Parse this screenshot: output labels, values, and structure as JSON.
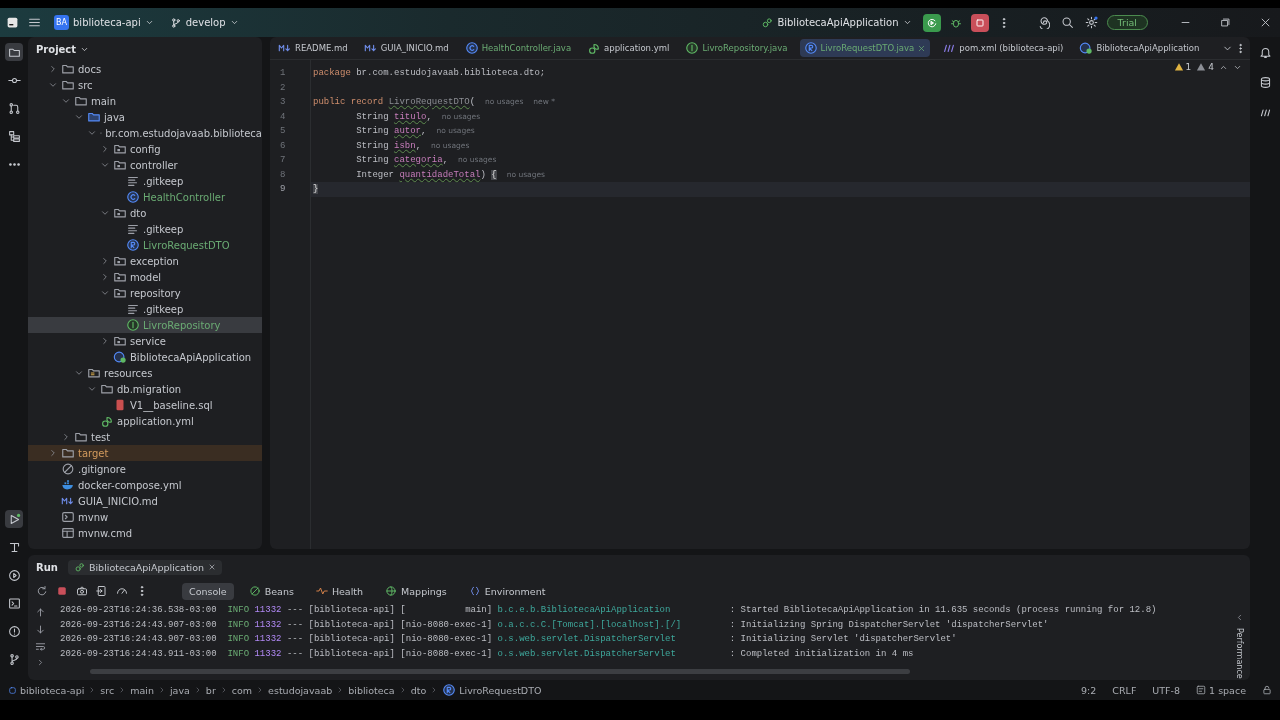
{
  "title_bar": {
    "project_badge": "BA",
    "project": "biblioteca-api",
    "branch": "develop",
    "run_config": "BibliotecaApiApplication",
    "trial": "Trial"
  },
  "project_panel": {
    "title": "Project",
    "tree": [
      {
        "label": "docs",
        "kind": "folder",
        "expanded": false,
        "selected": false
      },
      {
        "label": "src",
        "kind": "folder",
        "expanded": true,
        "selected": false,
        "children": [
          {
            "label": "main",
            "kind": "folder",
            "expanded": true,
            "selected": false,
            "children": [
              {
                "label": "java",
                "kind": "source-folder",
                "expanded": true,
                "selected": false,
                "children": [
                  {
                    "label": "br.com.estudojavaab.biblioteca",
                    "kind": "package",
                    "expanded": true,
                    "selected": false,
                    "children": [
                      {
                        "label": "config",
                        "kind": "package",
                        "expanded": false,
                        "selected": false
                      },
                      {
                        "label": "controller",
                        "kind": "package",
                        "expanded": true,
                        "selected": false,
                        "children": [
                          {
                            "label": ".gitkeep",
                            "kind": "text",
                            "selected": false
                          },
                          {
                            "label": "HealthController",
                            "kind": "class",
                            "added": true,
                            "selected": false
                          }
                        ]
                      },
                      {
                        "label": "dto",
                        "kind": "package",
                        "expanded": true,
                        "selected": false,
                        "children": [
                          {
                            "label": ".gitkeep",
                            "kind": "text",
                            "selected": false
                          },
                          {
                            "label": "LivroRequestDTO",
                            "kind": "record",
                            "added": true,
                            "selected": false
                          }
                        ]
                      },
                      {
                        "label": "exception",
                        "kind": "package",
                        "expanded": false,
                        "selected": false
                      },
                      {
                        "label": "model",
                        "kind": "package",
                        "expanded": false,
                        "selected": false
                      },
                      {
                        "label": "repository",
                        "kind": "package",
                        "expanded": true,
                        "selected": false,
                        "children": [
                          {
                            "label": ".gitkeep",
                            "kind": "text",
                            "selected": false
                          },
                          {
                            "label": "LivroRepository",
                            "kind": "interface",
                            "added": true,
                            "selected": true
                          }
                        ]
                      },
                      {
                        "label": "service",
                        "kind": "package",
                        "expanded": false,
                        "selected": false
                      },
                      {
                        "label": "BibliotecaApiApplication",
                        "kind": "spring",
                        "selected": false
                      }
                    ]
                  }
                ]
              },
              {
                "label": "resources",
                "kind": "resources-folder",
                "expanded": true,
                "selected": false,
                "children": [
                  {
                    "label": "db.migration",
                    "kind": "folder",
                    "expanded": true,
                    "selected": false,
                    "children": [
                      {
                        "label": "V1__baseline.sql",
                        "kind": "sql",
                        "selected": false
                      }
                    ]
                  },
                  {
                    "label": "application.yml",
                    "kind": "yml",
                    "selected": false
                  }
                ]
              }
            ]
          },
          {
            "label": "test",
            "kind": "folder",
            "expanded": false,
            "selected": false
          }
        ]
      },
      {
        "label": "target",
        "kind": "folder",
        "expanded": false,
        "excluded": true,
        "selected": false
      },
      {
        "label": ".gitignore",
        "kind": "ignore",
        "selected": false
      },
      {
        "label": "docker-compose.yml",
        "kind": "docker",
        "selected": false
      },
      {
        "label": "GUIA_INICIO.md",
        "kind": "md",
        "selected": false
      },
      {
        "label": "mvnw",
        "kind": "script",
        "selected": false
      },
      {
        "label": "mvnw.cmd",
        "kind": "cmd",
        "selected": false
      }
    ]
  },
  "editor_tabs": [
    {
      "label": "README.md",
      "kind": "md",
      "selected": false
    },
    {
      "label": "GUIA_INICIO.md",
      "kind": "md",
      "selected": false
    },
    {
      "label": "HealthController.java",
      "kind": "class",
      "added": true,
      "selected": false
    },
    {
      "label": "application.yml",
      "kind": "yml",
      "selected": false
    },
    {
      "label": "LivroRepository.java",
      "kind": "interface",
      "added": true,
      "selected": false
    },
    {
      "label": "LivroRequestDTO.java",
      "kind": "record",
      "added": true,
      "selected": true
    },
    {
      "label": "pom.xml (biblioteca-api)",
      "kind": "maven",
      "selected": false
    },
    {
      "label": "BibliotecaApiApplication",
      "kind": "spring",
      "selected": false
    }
  ],
  "inspections": {
    "warnings": "1",
    "weak_warnings": "4"
  },
  "code": [
    {
      "number": "1",
      "current": false,
      "tokens": [
        {
          "kind": "keyword",
          "text": "package"
        },
        {
          "kind": "plain",
          "text": " br.com.estudojavaab.biblioteca.dto;"
        }
      ]
    },
    {
      "number": "2",
      "current": false
    },
    {
      "number": "3",
      "current": false,
      "tokens": [
        {
          "kind": "keyword",
          "text": "public record "
        },
        {
          "kind": "unused",
          "text": "LivroRequestDTO"
        },
        {
          "kind": "plain",
          "text": "("
        }
      ],
      "hints": [
        "no usages",
        "new *"
      ]
    },
    {
      "number": "4",
      "current": false,
      "tokens": [
        {
          "kind": "plain",
          "text": "        String "
        },
        {
          "kind": "param",
          "text": "titulo"
        },
        {
          "kind": "plain",
          "text": ","
        }
      ],
      "hints": [
        "no usages"
      ]
    },
    {
      "number": "5",
      "current": false,
      "tokens": [
        {
          "kind": "plain",
          "text": "        String "
        },
        {
          "kind": "param",
          "text": "autor"
        },
        {
          "kind": "plain",
          "text": ","
        }
      ],
      "hints": [
        "no usages"
      ]
    },
    {
      "number": "6",
      "current": false,
      "tokens": [
        {
          "kind": "plain",
          "text": "        String "
        },
        {
          "kind": "param",
          "text": "isbn"
        },
        {
          "kind": "plain",
          "text": ","
        }
      ],
      "hints": [
        "no usages"
      ]
    },
    {
      "number": "7",
      "current": false,
      "tokens": [
        {
          "kind": "plain",
          "text": "        String "
        },
        {
          "kind": "param",
          "text": "categoria"
        },
        {
          "kind": "plain",
          "text": ","
        }
      ],
      "hints": [
        "no usages"
      ]
    },
    {
      "number": "8",
      "current": false,
      "tokens": [
        {
          "kind": "plain",
          "text": "        Integer "
        },
        {
          "kind": "param",
          "text": "quantidadeTotal"
        },
        {
          "kind": "plain",
          "text": ") "
        },
        {
          "kind": "brace-match",
          "text": "{"
        }
      ],
      "hints": [
        "no usages"
      ]
    },
    {
      "number": "9",
      "current": true,
      "tokens": [
        {
          "kind": "brace-match",
          "text": "}"
        }
      ]
    }
  ],
  "run_panel": {
    "title": "Run",
    "config_tab": "BibliotecaApiApplication",
    "tabs": [
      {
        "label": "Console",
        "kind": "console",
        "selected": true
      },
      {
        "label": "Beans",
        "kind": "beans",
        "selected": false
      },
      {
        "label": "Health",
        "kind": "health",
        "selected": false
      },
      {
        "label": "Mappings",
        "kind": "mappings",
        "selected": false
      },
      {
        "label": "Environment",
        "kind": "environment",
        "selected": false
      }
    ],
    "log": [
      {
        "time": "2026-09-23T16:24:36.538-03:00",
        "level": "INFO",
        "pid": "11332",
        "sep": "---",
        "app": "[biblioteca-api]",
        "thread": "[           main]",
        "logger": "b.c.e.b.BibliotecaApiApplication",
        "message": ": Started BibliotecaApiApplication in 11.635 seconds (process running for 12.8)"
      },
      {
        "time": "2026-09-23T16:24:43.907-03:00",
        "level": "INFO",
        "pid": "11332",
        "sep": "---",
        "app": "[biblioteca-api]",
        "thread": "[nio-8080-exec-1]",
        "logger": "o.a.c.c.C.[Tomcat].[localhost].[/]",
        "message": ": Initializing Spring DispatcherServlet 'dispatcherServlet'"
      },
      {
        "time": "2026-09-23T16:24:43.907-03:00",
        "level": "INFO",
        "pid": "11332",
        "sep": "---",
        "app": "[biblioteca-api]",
        "thread": "[nio-8080-exec-1]",
        "logger": "o.s.web.servlet.DispatcherServlet",
        "message": ": Initializing Servlet 'dispatcherServlet'"
      },
      {
        "time": "2026-09-23T16:24:43.911-03:00",
        "level": "INFO",
        "pid": "11332",
        "sep": "---",
        "app": "[biblioteca-api]",
        "thread": "[nio-8080-exec-1]",
        "logger": "o.s.web.servlet.DispatcherServlet",
        "message": ": Completed initialization in 4 ms"
      }
    ],
    "side_label": "Performance"
  },
  "status_bar": {
    "breadcrumbs": [
      "biblioteca-api",
      "src",
      "main",
      "java",
      "br",
      "com",
      "estudojavaab",
      "biblioteca",
      "dto",
      "LivroRequestDTO"
    ],
    "position": "9:2",
    "line_separator": "CRLF",
    "encoding": "UTF-8",
    "indent": "1 space"
  }
}
